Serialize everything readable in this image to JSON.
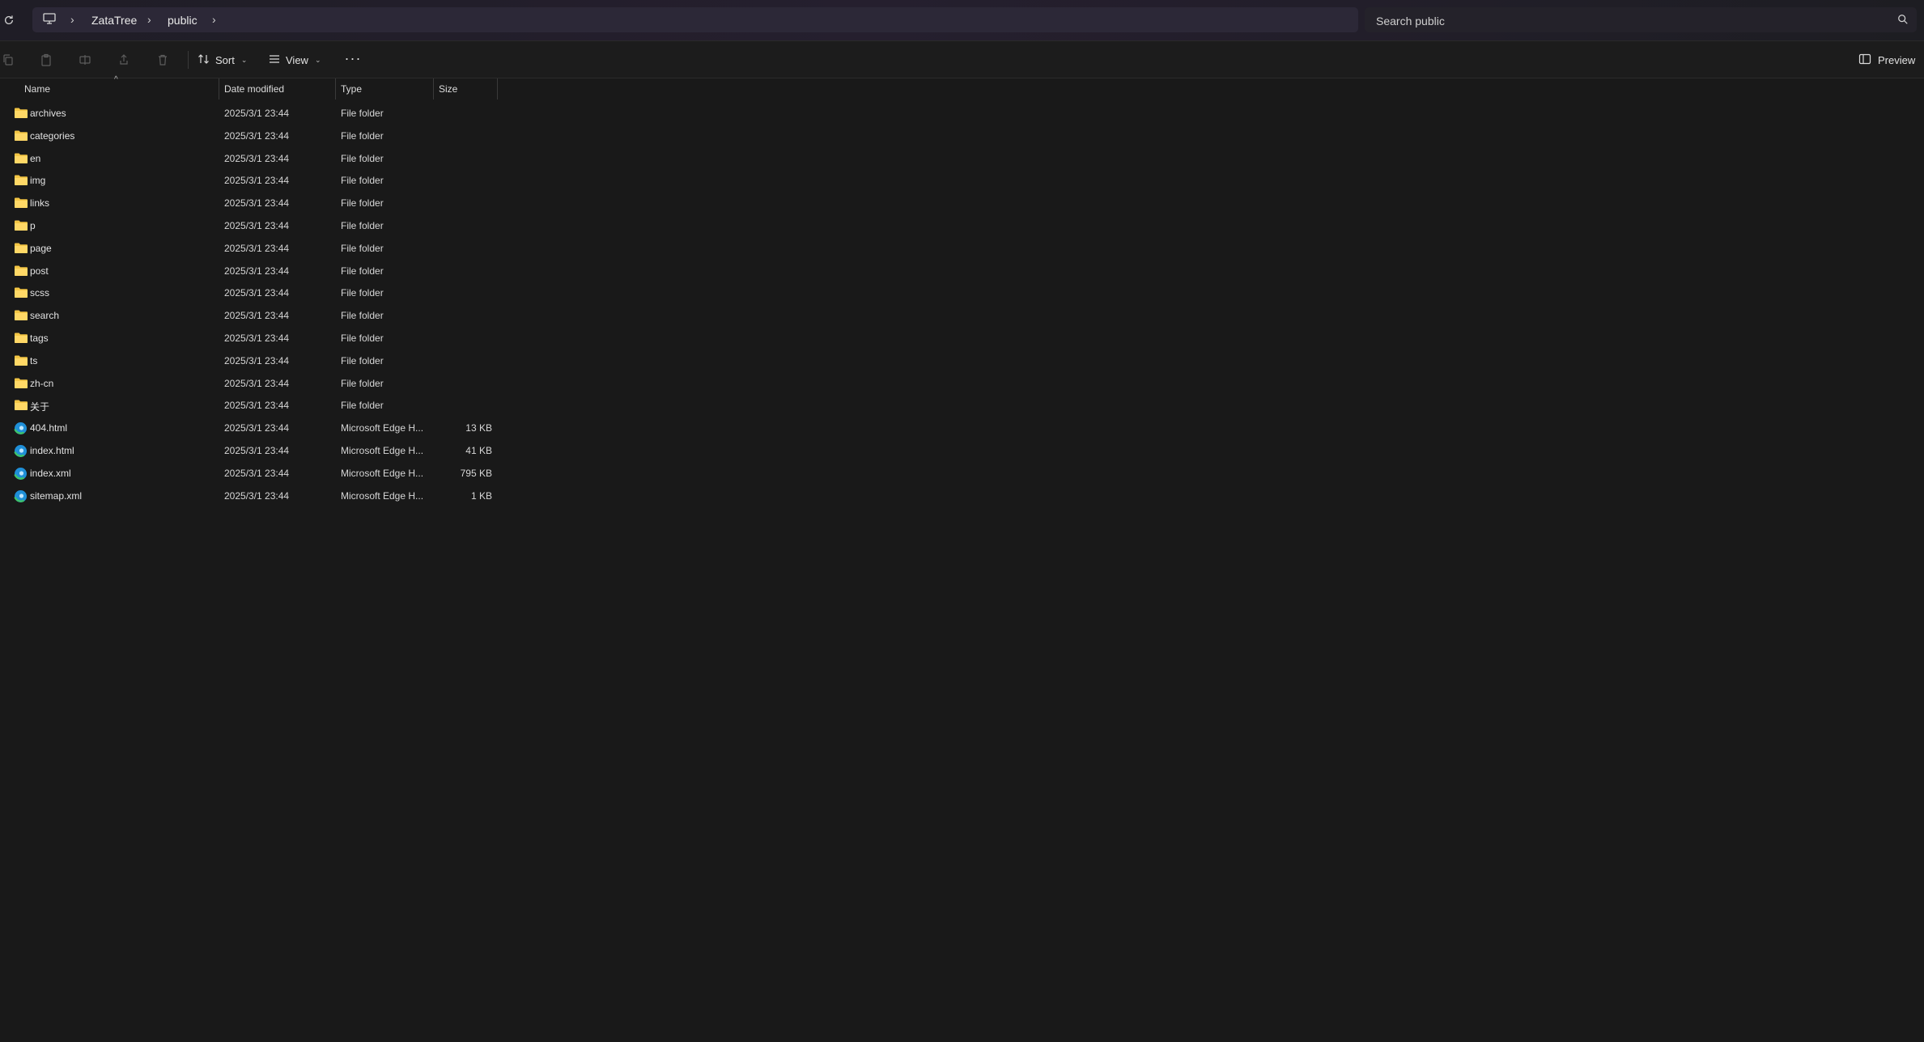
{
  "address": {
    "breadcrumbs": [
      "ZataTree",
      "public"
    ],
    "search_placeholder": "Search public"
  },
  "commandbar": {
    "sort_label": "Sort",
    "view_label": "View",
    "more_label": "···",
    "preview_label": "Preview"
  },
  "columns": {
    "name": "Name",
    "date": "Date modified",
    "type": "Type",
    "size": "Size"
  },
  "files": [
    {
      "name": "archives",
      "date": "2025/3/1 23:44",
      "type": "File folder",
      "size": "",
      "icon": "folder-icon"
    },
    {
      "name": "categories",
      "date": "2025/3/1 23:44",
      "type": "File folder",
      "size": "",
      "icon": "folder-icon"
    },
    {
      "name": "en",
      "date": "2025/3/1 23:44",
      "type": "File folder",
      "size": "",
      "icon": "folder-icon"
    },
    {
      "name": "img",
      "date": "2025/3/1 23:44",
      "type": "File folder",
      "size": "",
      "icon": "folder-icon"
    },
    {
      "name": "links",
      "date": "2025/3/1 23:44",
      "type": "File folder",
      "size": "",
      "icon": "folder-icon"
    },
    {
      "name": "p",
      "date": "2025/3/1 23:44",
      "type": "File folder",
      "size": "",
      "icon": "folder-icon"
    },
    {
      "name": "page",
      "date": "2025/3/1 23:44",
      "type": "File folder",
      "size": "",
      "icon": "folder-icon"
    },
    {
      "name": "post",
      "date": "2025/3/1 23:44",
      "type": "File folder",
      "size": "",
      "icon": "folder-icon"
    },
    {
      "name": "scss",
      "date": "2025/3/1 23:44",
      "type": "File folder",
      "size": "",
      "icon": "folder-icon"
    },
    {
      "name": "search",
      "date": "2025/3/1 23:44",
      "type": "File folder",
      "size": "",
      "icon": "folder-icon"
    },
    {
      "name": "tags",
      "date": "2025/3/1 23:44",
      "type": "File folder",
      "size": "",
      "icon": "folder-icon"
    },
    {
      "name": "ts",
      "date": "2025/3/1 23:44",
      "type": "File folder",
      "size": "",
      "icon": "folder-icon"
    },
    {
      "name": "zh-cn",
      "date": "2025/3/1 23:44",
      "type": "File folder",
      "size": "",
      "icon": "folder-icon"
    },
    {
      "name": "关于",
      "date": "2025/3/1 23:44",
      "type": "File folder",
      "size": "",
      "icon": "folder-icon"
    },
    {
      "name": "404.html",
      "date": "2025/3/1 23:44",
      "type": "Microsoft Edge H...",
      "size": "13 KB",
      "icon": "edge-icon"
    },
    {
      "name": "index.html",
      "date": "2025/3/1 23:44",
      "type": "Microsoft Edge H...",
      "size": "41 KB",
      "icon": "edge-icon"
    },
    {
      "name": "index.xml",
      "date": "2025/3/1 23:44",
      "type": "Microsoft Edge H...",
      "size": "795 KB",
      "icon": "edge-icon"
    },
    {
      "name": "sitemap.xml",
      "date": "2025/3/1 23:44",
      "type": "Microsoft Edge H...",
      "size": "1 KB",
      "icon": "edge-icon"
    }
  ],
  "colors": {
    "folder": "#f3c544",
    "edge_blue": "#1f8fd8",
    "edge_green": "#3ec36a"
  }
}
